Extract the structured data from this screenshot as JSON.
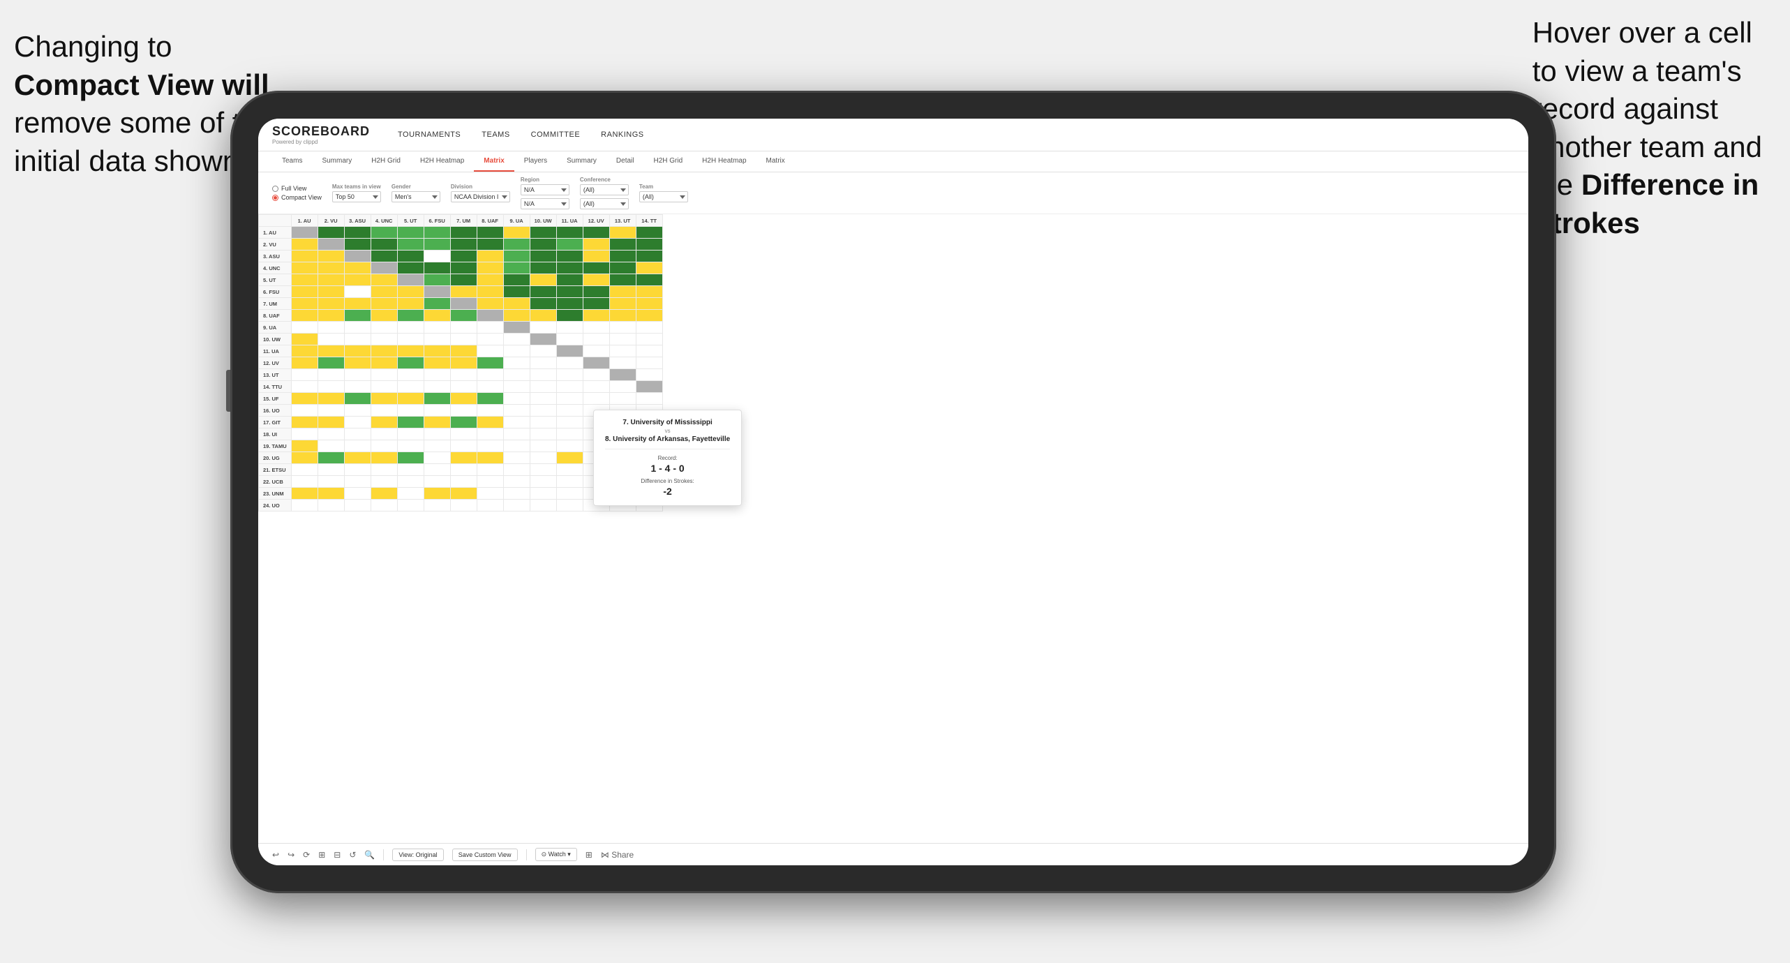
{
  "annotations": {
    "left": {
      "line1": "Changing to",
      "line2bold": "Compact View will",
      "line3": "remove some of the",
      "line4": "initial data shown"
    },
    "right": {
      "line1": "Hover over a cell",
      "line2": "to view a team's",
      "line3": "record against",
      "line4": "another team and",
      "line5bold": "the ",
      "line5boldcont": "Difference in",
      "line6bold": "Strokes"
    }
  },
  "header": {
    "logo": "SCOREBOARD",
    "logo_sub": "Powered by clippd",
    "nav_items": [
      "TOURNAMENTS",
      "TEAMS",
      "COMMITTEE",
      "RANKINGS"
    ]
  },
  "sub_nav": {
    "groups": [
      {
        "label": "Teams",
        "active": false
      },
      {
        "label": "Summary",
        "active": false
      },
      {
        "label": "H2H Grid",
        "active": false
      },
      {
        "label": "H2H Heatmap",
        "active": false
      },
      {
        "label": "Matrix",
        "active": true
      },
      {
        "label": "Players",
        "active": false
      },
      {
        "label": "Summary",
        "active": false
      },
      {
        "label": "Detail",
        "active": false
      },
      {
        "label": "H2H Grid",
        "active": false
      },
      {
        "label": "H2H Heatmap",
        "active": false
      },
      {
        "label": "Matrix",
        "active": false
      }
    ]
  },
  "filters": {
    "view_options": [
      "Full View",
      "Compact View"
    ],
    "selected_view": "Compact View",
    "max_teams_label": "Max teams in view",
    "max_teams_value": "Top 50",
    "gender_label": "Gender",
    "gender_value": "Men's",
    "division_label": "Division",
    "division_value": "NCAA Division I",
    "region_label": "Region",
    "region_values": [
      "N/A",
      "N/A"
    ],
    "conference_label": "Conference",
    "conference_values": [
      "(All)",
      "(All)"
    ],
    "team_label": "Team",
    "team_values": [
      "(All)"
    ]
  },
  "matrix": {
    "col_headers": [
      "1. AU",
      "2. VU",
      "3. ASU",
      "4. UNC",
      "5. UT",
      "6. FSU",
      "7. UM",
      "8. UAF",
      "9. UA",
      "10. UW",
      "11. UA",
      "12. UV",
      "13. UT",
      "14. TT"
    ],
    "rows": [
      {
        "label": "1. AU",
        "cells": [
          "diag",
          "green-dark",
          "green-dark",
          "green-med",
          "green-med",
          "green-med",
          "green-dark",
          "green-dark",
          "yellow",
          "green-dark",
          "green-dark",
          "green-dark",
          "yellow",
          "green-dark"
        ]
      },
      {
        "label": "2. VU",
        "cells": [
          "yellow",
          "diag",
          "green-dark",
          "green-dark",
          "green-med",
          "green-med",
          "green-dark",
          "green-dark",
          "green-med",
          "green-dark",
          "green-med",
          "yellow",
          "green-dark",
          "green-dark"
        ]
      },
      {
        "label": "3. ASU",
        "cells": [
          "yellow",
          "yellow",
          "diag",
          "green-dark",
          "green-dark",
          "white",
          "green-dark",
          "yellow",
          "green-med",
          "green-dark",
          "green-dark",
          "yellow",
          "green-dark",
          "green-dark"
        ]
      },
      {
        "label": "4. UNC",
        "cells": [
          "yellow",
          "yellow",
          "yellow",
          "diag",
          "green-dark",
          "green-dark",
          "green-dark",
          "yellow",
          "green-med",
          "green-dark",
          "green-dark",
          "green-dark",
          "green-dark",
          "yellow"
        ]
      },
      {
        "label": "5. UT",
        "cells": [
          "yellow",
          "yellow",
          "yellow",
          "yellow",
          "diag",
          "green-med",
          "green-dark",
          "yellow",
          "green-dark",
          "yellow",
          "green-dark",
          "yellow",
          "green-dark",
          "green-dark"
        ]
      },
      {
        "label": "6. FSU",
        "cells": [
          "yellow",
          "yellow",
          "white",
          "yellow",
          "yellow",
          "diag",
          "yellow",
          "yellow",
          "green-dark",
          "green-dark",
          "green-dark",
          "green-dark",
          "yellow",
          "yellow"
        ]
      },
      {
        "label": "7. UM",
        "cells": [
          "yellow",
          "yellow",
          "yellow",
          "yellow",
          "yellow",
          "green-med",
          "diag",
          "yellow",
          "yellow",
          "green-dark",
          "green-dark",
          "green-dark",
          "yellow",
          "yellow"
        ]
      },
      {
        "label": "8. UAF",
        "cells": [
          "yellow",
          "yellow",
          "green-med",
          "yellow",
          "green-med",
          "yellow",
          "green-med",
          "diag",
          "yellow",
          "yellow",
          "green-dark",
          "yellow",
          "yellow",
          "yellow"
        ]
      },
      {
        "label": "9. UA",
        "cells": [
          "white",
          "white",
          "white",
          "white",
          "white",
          "white",
          "white",
          "white",
          "diag",
          "white",
          "white",
          "white",
          "white",
          "white"
        ]
      },
      {
        "label": "10. UW",
        "cells": [
          "yellow",
          "white",
          "white",
          "white",
          "white",
          "white",
          "white",
          "white",
          "white",
          "diag",
          "white",
          "white",
          "white",
          "white"
        ]
      },
      {
        "label": "11. UA",
        "cells": [
          "yellow",
          "yellow",
          "yellow",
          "yellow",
          "yellow",
          "yellow",
          "yellow",
          "white",
          "white",
          "white",
          "diag",
          "white",
          "white",
          "white"
        ]
      },
      {
        "label": "12. UV",
        "cells": [
          "yellow",
          "green-med",
          "yellow",
          "yellow",
          "green-med",
          "yellow",
          "yellow",
          "green-med",
          "white",
          "white",
          "white",
          "diag",
          "white",
          "white"
        ]
      },
      {
        "label": "13. UT",
        "cells": [
          "white",
          "white",
          "white",
          "white",
          "white",
          "white",
          "white",
          "white",
          "white",
          "white",
          "white",
          "white",
          "diag",
          "white"
        ]
      },
      {
        "label": "14. TTU",
        "cells": [
          "white",
          "white",
          "white",
          "white",
          "white",
          "white",
          "white",
          "white",
          "white",
          "white",
          "white",
          "white",
          "white",
          "diag"
        ]
      },
      {
        "label": "15. UF",
        "cells": [
          "yellow",
          "yellow",
          "green-med",
          "yellow",
          "yellow",
          "green-med",
          "yellow",
          "green-med",
          "white",
          "white",
          "white",
          "white",
          "white",
          "white"
        ]
      },
      {
        "label": "16. UO",
        "cells": [
          "white",
          "white",
          "white",
          "white",
          "white",
          "white",
          "white",
          "white",
          "white",
          "white",
          "white",
          "white",
          "white",
          "white"
        ]
      },
      {
        "label": "17. GIT",
        "cells": [
          "yellow",
          "yellow",
          "white",
          "yellow",
          "green-med",
          "yellow",
          "green-med",
          "yellow",
          "white",
          "white",
          "white",
          "white",
          "white",
          "white"
        ]
      },
      {
        "label": "18. UI",
        "cells": [
          "white",
          "white",
          "white",
          "white",
          "white",
          "white",
          "white",
          "white",
          "white",
          "white",
          "white",
          "white",
          "white",
          "white"
        ]
      },
      {
        "label": "19. TAMU",
        "cells": [
          "yellow",
          "white",
          "white",
          "white",
          "white",
          "white",
          "white",
          "white",
          "white",
          "white",
          "white",
          "white",
          "white",
          "white"
        ]
      },
      {
        "label": "20. UG",
        "cells": [
          "yellow",
          "green-med",
          "yellow",
          "yellow",
          "green-med",
          "white",
          "yellow",
          "yellow",
          "white",
          "white",
          "yellow",
          "white",
          "white",
          "white"
        ]
      },
      {
        "label": "21. ETSU",
        "cells": [
          "white",
          "white",
          "white",
          "white",
          "white",
          "white",
          "white",
          "white",
          "white",
          "white",
          "white",
          "white",
          "white",
          "white"
        ]
      },
      {
        "label": "22. UCB",
        "cells": [
          "white",
          "white",
          "white",
          "white",
          "white",
          "white",
          "white",
          "white",
          "white",
          "white",
          "white",
          "white",
          "white",
          "white"
        ]
      },
      {
        "label": "23. UNM",
        "cells": [
          "yellow",
          "yellow",
          "white",
          "yellow",
          "white",
          "yellow",
          "yellow",
          "white",
          "white",
          "white",
          "white",
          "white",
          "white",
          "white"
        ]
      },
      {
        "label": "24. UO",
        "cells": [
          "white",
          "white",
          "white",
          "white",
          "white",
          "white",
          "white",
          "white",
          "white",
          "white",
          "white",
          "white",
          "white",
          "white"
        ]
      }
    ]
  },
  "tooltip": {
    "team1": "7. University of Mississippi",
    "vs": "vs",
    "team2": "8. University of Arkansas, Fayetteville",
    "record_label": "Record:",
    "record_value": "1 - 4 - 0",
    "strokes_label": "Difference in Strokes:",
    "strokes_value": "-2"
  },
  "toolbar": {
    "buttons": [
      "View: Original",
      "Save Custom View",
      "Watch ▾"
    ],
    "icons": [
      "↩",
      "↪",
      "⟳",
      "⊞",
      "⊟",
      "↺",
      "🔍"
    ]
  }
}
